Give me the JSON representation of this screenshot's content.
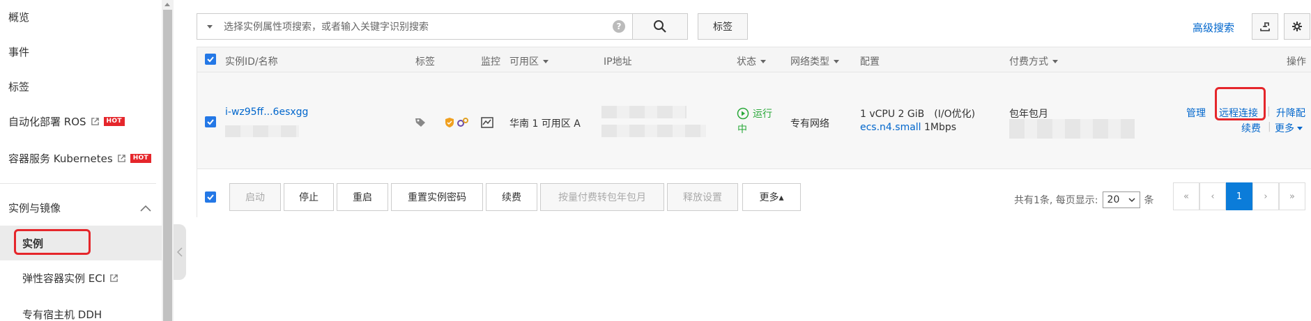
{
  "sidebar": {
    "items": [
      {
        "label": "概览"
      },
      {
        "label": "事件"
      },
      {
        "label": "标签"
      },
      {
        "label": "自动化部署 ROS",
        "hot": "HOT"
      },
      {
        "label": "容器服务 Kubernetes",
        "hot": "HOT"
      }
    ],
    "group": {
      "label": "实例与镜像"
    },
    "sub_items": [
      {
        "label": "实例"
      },
      {
        "label": "弹性容器实例 ECI"
      },
      {
        "label": "专有宿主机 DDH"
      }
    ]
  },
  "toolbar": {
    "search_placeholder": "选择实例属性项搜索，或者输入关键字识别搜索",
    "help": "?",
    "tag_label": "标签",
    "advanced_search": "高级搜索"
  },
  "table": {
    "headers": {
      "id_name": "实例ID/名称",
      "tag": "标签",
      "monitor": "监控",
      "zone": "可用区",
      "ip": "IP地址",
      "status": "状态",
      "network": "网络类型",
      "config": "配置",
      "billing": "付费方式",
      "actions": "操作"
    },
    "row": {
      "instance_id": "i-wz95ff...6esxgg",
      "zone": "华南 1 可用区 A",
      "status_line1": "运行",
      "status_line2": "中",
      "network": "专有网络",
      "config_line1": "1 vCPU 2 GiB　(I/O优化)",
      "config_type": "ecs.n4.small",
      "config_bandwidth": "1Mbps",
      "billing": "包年包月",
      "actions": {
        "manage": "管理",
        "remote": "远程连接",
        "upgrade": "升降配",
        "renew": "续费",
        "more": "更多"
      }
    }
  },
  "footer": {
    "buttons": [
      {
        "label": "启动",
        "disabled": true
      },
      {
        "label": "停止",
        "disabled": false
      },
      {
        "label": "重启",
        "disabled": false
      },
      {
        "label": "重置实例密码",
        "disabled": false
      },
      {
        "label": "续费",
        "disabled": false
      },
      {
        "label": "按量付费转包年包月",
        "disabled": true
      },
      {
        "label": "释放设置",
        "disabled": true
      },
      {
        "label": "更多▴",
        "disabled": false
      }
    ],
    "page_info_prefix": "共有1条, 每页显示:",
    "page_size": "20",
    "page_info_suffix": "条",
    "pager": {
      "first": "«",
      "prev": "‹",
      "current": "1",
      "next": "›",
      "last": "»"
    }
  },
  "colors": {
    "accent": "#0066cc",
    "highlight_box": "#e5262b",
    "running": "#2aa83a",
    "checkbox": "#2478e6"
  }
}
